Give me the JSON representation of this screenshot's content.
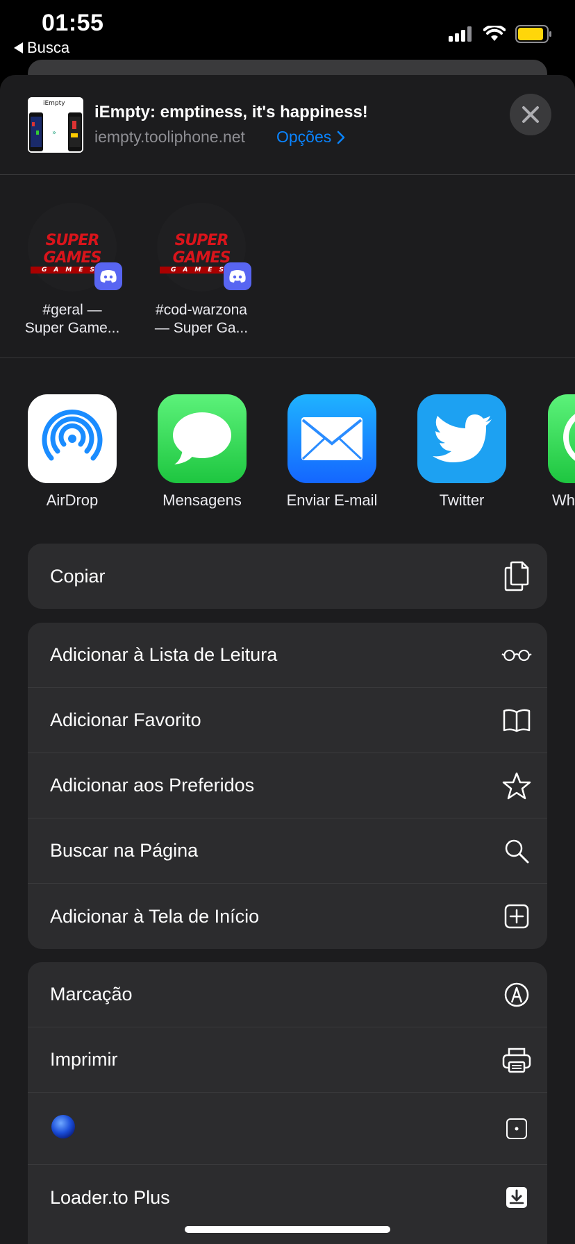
{
  "status_bar": {
    "time": "01:55",
    "back_label": "Busca"
  },
  "share_header": {
    "title": "iEmpty: emptiness, it's happiness!",
    "url": "iempty.tooliphone.net",
    "options_label": "Opções",
    "thumb_text": "iEmpty"
  },
  "people": [
    {
      "line1": "#geral —",
      "line2": "Super Game...",
      "logo_main": "SUPER GAMES",
      "logo_sub": "GAMES"
    },
    {
      "line1": "#cod-warzona",
      "line2": "— Super Ga...",
      "logo_main": "SUPER GAMES",
      "logo_sub": "GAMES"
    }
  ],
  "apps": [
    {
      "label": "AirDrop"
    },
    {
      "label": "Mensagens"
    },
    {
      "label": "Enviar E-mail"
    },
    {
      "label": "Twitter"
    },
    {
      "label": "Wh"
    }
  ],
  "actions": {
    "group1": [
      {
        "label": "Copiar",
        "icon": "copy-icon"
      }
    ],
    "group2": [
      {
        "label": "Adicionar à Lista de Leitura",
        "icon": "glasses-icon"
      },
      {
        "label": "Adicionar Favorito",
        "icon": "book-icon"
      },
      {
        "label": "Adicionar aos Preferidos",
        "icon": "star-icon"
      },
      {
        "label": "Buscar na Página",
        "icon": "search-icon"
      },
      {
        "label": "Adicionar à Tela de Início",
        "icon": "add-square-icon"
      }
    ],
    "group3": [
      {
        "label": "Marcação",
        "icon": "markup-icon"
      },
      {
        "label": "Imprimir",
        "icon": "printer-icon"
      },
      {
        "label": "",
        "icon": "blue-dot-icon"
      },
      {
        "label": "Loader.to Plus",
        "icon": "download-icon"
      }
    ]
  },
  "colors": {
    "accent": "#0a84ff",
    "sheet": "#1c1c1e",
    "group": "#2c2c2e",
    "battery": "#ffd60a"
  }
}
